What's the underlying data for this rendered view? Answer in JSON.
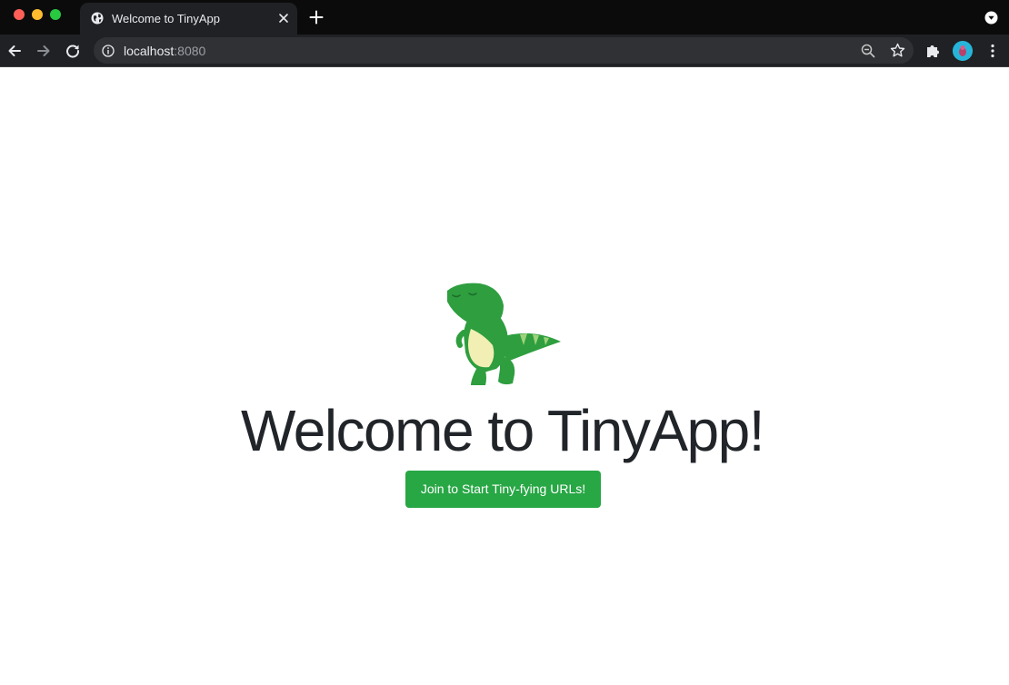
{
  "browser": {
    "tab": {
      "title": "Welcome to TinyApp"
    },
    "address_bar": {
      "host": "localhost",
      "port": ":8080"
    }
  },
  "page": {
    "heading": "Welcome to TinyApp!",
    "join_button_label": "Join to Start Tiny-fying URLs!",
    "mascot_icon": "dinosaur-icon"
  },
  "colors": {
    "button_green": "#28a745",
    "dino_green": "#2e9e3f",
    "dino_belly": "#f2efb4",
    "heading_text": "#212529"
  }
}
